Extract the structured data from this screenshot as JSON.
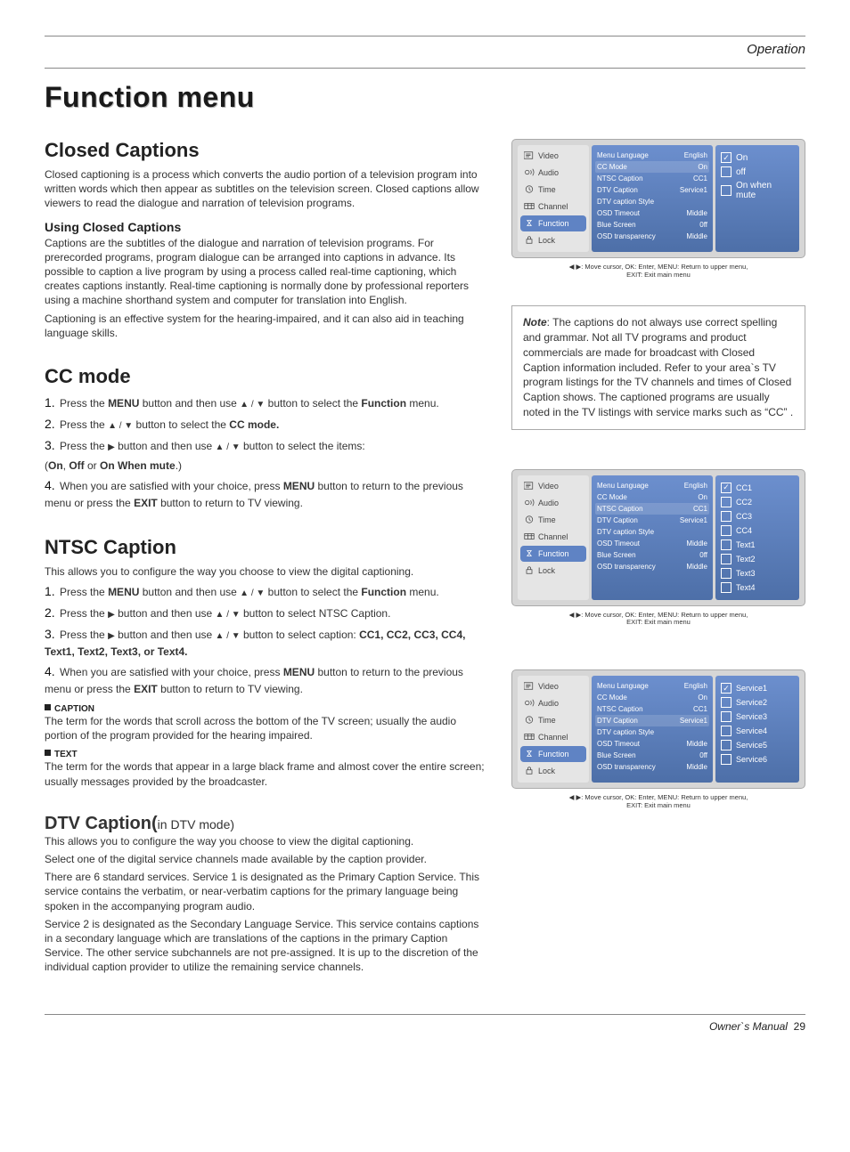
{
  "header": {
    "section": "Operation"
  },
  "page_title": "Function menu",
  "footer": {
    "label": "Owner`s Manual",
    "page": "29"
  },
  "closed_captions": {
    "heading": "Closed Captions",
    "intro": "Closed captioning is a process which converts the audio portion of a television program into written words which then appear as subtitles on the television screen. Closed captions allow viewers to read the dialogue and narration of television programs.",
    "using_heading": "Using Closed Captions",
    "using_body_1": "Captions are the subtitles of the dialogue and narration of television programs. For prerecorded programs, program dialogue can be arranged into captions in advance. Its possible to caption a live program by using a process called real-time captioning, which creates captions instantly. Real-time captioning is normally done by professional reporters using a machine shorthand system and computer for translation into English.",
    "using_body_2": "Captioning is an effective system for the hearing-impaired, and it can also aid in teaching language skills."
  },
  "cc_mode": {
    "heading": "CC mode",
    "step1_a": "Press the ",
    "step1_b": " button and then use ",
    "step1_c": " button to select the ",
    "step1_menu_word": "Function",
    "step1_d": " menu.",
    "step2_a": "Press the ",
    "step2_b": " button to select the ",
    "step2_mode_word": "CC mode.",
    "step3_a": "Press the ",
    "step3_b": " button and then use ",
    "step3_c": " button to select the  items:",
    "step3_opts_a": "On",
    "step3_opts_b": "Off",
    "step3_opts_c": "On When mute",
    "step3_paren_start": "(",
    "step3_paren_end": ".)",
    "step4_a": "When you are satisfied with your choice,  press ",
    "step4_b": " button to return to the previous menu or press the ",
    "step4_c": " button to return to TV viewing.",
    "menu_word": "MENU",
    "exit_word": "EXIT"
  },
  "ntsc": {
    "heading": "NTSC Caption",
    "intro": "This allows you to configure the way you choose to view the digital captioning.",
    "step1_a": "Press the ",
    "step1_b": " button and then use ",
    "step1_c": " button to select the ",
    "step1_menu_word": "Function",
    "step1_d": " menu.",
    "step2_a": "Press the ",
    "step2_b": " button and then use ",
    "step2_c": " button to select NTSC Caption.",
    "step3_a": "Press the ",
    "step3_b": " button and then use ",
    "step3_c": " button to select caption: ",
    "step3_opts": "CC1, CC2, CC3, CC4, Text1, Text2, Text3, or Text4.",
    "step4_a": "When you are satisfied with your choice,  press ",
    "step4_b": " button to return to  the previous menu or press the ",
    "step4_c": " button to return to TV viewing.",
    "caption_sub": "CAPTION",
    "caption_body": "The term for the words that scroll across the bottom of the TV screen; usually the audio portion of the program provided for the hearing impaired.",
    "text_sub": "TEXT",
    "text_body": "The term for the words that appear in a large black frame and almost cover the entire screen; usually messages provided by the broadcaster."
  },
  "dtv": {
    "heading": "DTV Caption(",
    "suffix": "in DTV mode)",
    "intro": "This allows you to configure the way you choose to view the digital captioning.",
    "p1": "Select one of the digital service channels made available by the caption provider.",
    "p2": "There are 6 standard services. Service 1 is designated as the Primary Caption Service. This service contains the verbatim, or near-verbatim captions for the primary language being spoken in the accompanying program audio.",
    "p3": "Service 2 is designated as the Secondary Language Service. This service contains captions in a secondary language which are translations of the captions in the primary Caption Service. The other service subchannels are not pre-assigned. It is up to the discretion of the individual caption provider to utilize the remaining service channels."
  },
  "note": {
    "label": "Note",
    "body": ": The captions do not always use correct spelling and grammar. Not all TV programs and product commercials are made for broadcast with Closed Caption information included. Refer to your area`s TV program listings for the TV channels and times of Closed Caption shows. The captioned programs are usually noted in the TV listings with service marks such as “CC” ."
  },
  "osd_nav": [
    "Video",
    "Audio",
    "Time",
    "Channel",
    "Function",
    "Lock"
  ],
  "osd_settings": {
    "rows": [
      {
        "label": "Menu Language",
        "value": "English"
      },
      {
        "label": "CC Mode",
        "value": "On"
      },
      {
        "label": "NTSC Caption",
        "value": "CC1"
      },
      {
        "label": "DTV Caption",
        "value": "Service1"
      },
      {
        "label": "DTV caption Style",
        "value": ""
      },
      {
        "label": "OSD Timeout",
        "value": "Middle"
      },
      {
        "label": "Blue Screen",
        "value": "0ff"
      },
      {
        "label": "OSD transparency",
        "value": "Middle"
      }
    ]
  },
  "osd1": {
    "highlight_row": "CC Mode",
    "options": [
      {
        "label": "On",
        "checked": true
      },
      {
        "label": "off",
        "checked": false
      },
      {
        "label": "On when mute",
        "checked": false
      }
    ]
  },
  "osd2": {
    "highlight_row": "NTSC Caption",
    "options": [
      {
        "label": "CC1",
        "checked": true
      },
      {
        "label": "CC2",
        "checked": false
      },
      {
        "label": "CC3",
        "checked": false
      },
      {
        "label": "CC4",
        "checked": false
      },
      {
        "label": "Text1",
        "checked": false
      },
      {
        "label": "Text2",
        "checked": false
      },
      {
        "label": "Text3",
        "checked": false
      },
      {
        "label": "Text4",
        "checked": false
      }
    ]
  },
  "osd3": {
    "highlight_row": "DTV Caption",
    "options": [
      {
        "label": "Service1",
        "checked": true
      },
      {
        "label": "Service2",
        "checked": false
      },
      {
        "label": "Service3",
        "checked": false
      },
      {
        "label": "Service4",
        "checked": false
      },
      {
        "label": "Service5",
        "checked": false
      },
      {
        "label": "Service6",
        "checked": false
      }
    ]
  },
  "osd_footer": {
    "line1": "◀ ▶: Move cursor,   OK: Enter, MENU: Return to upper menu,",
    "line2": "EXIT: Exit main menu"
  },
  "glyph": {
    "up_down": "▲ / ▼",
    "right": "▶"
  }
}
